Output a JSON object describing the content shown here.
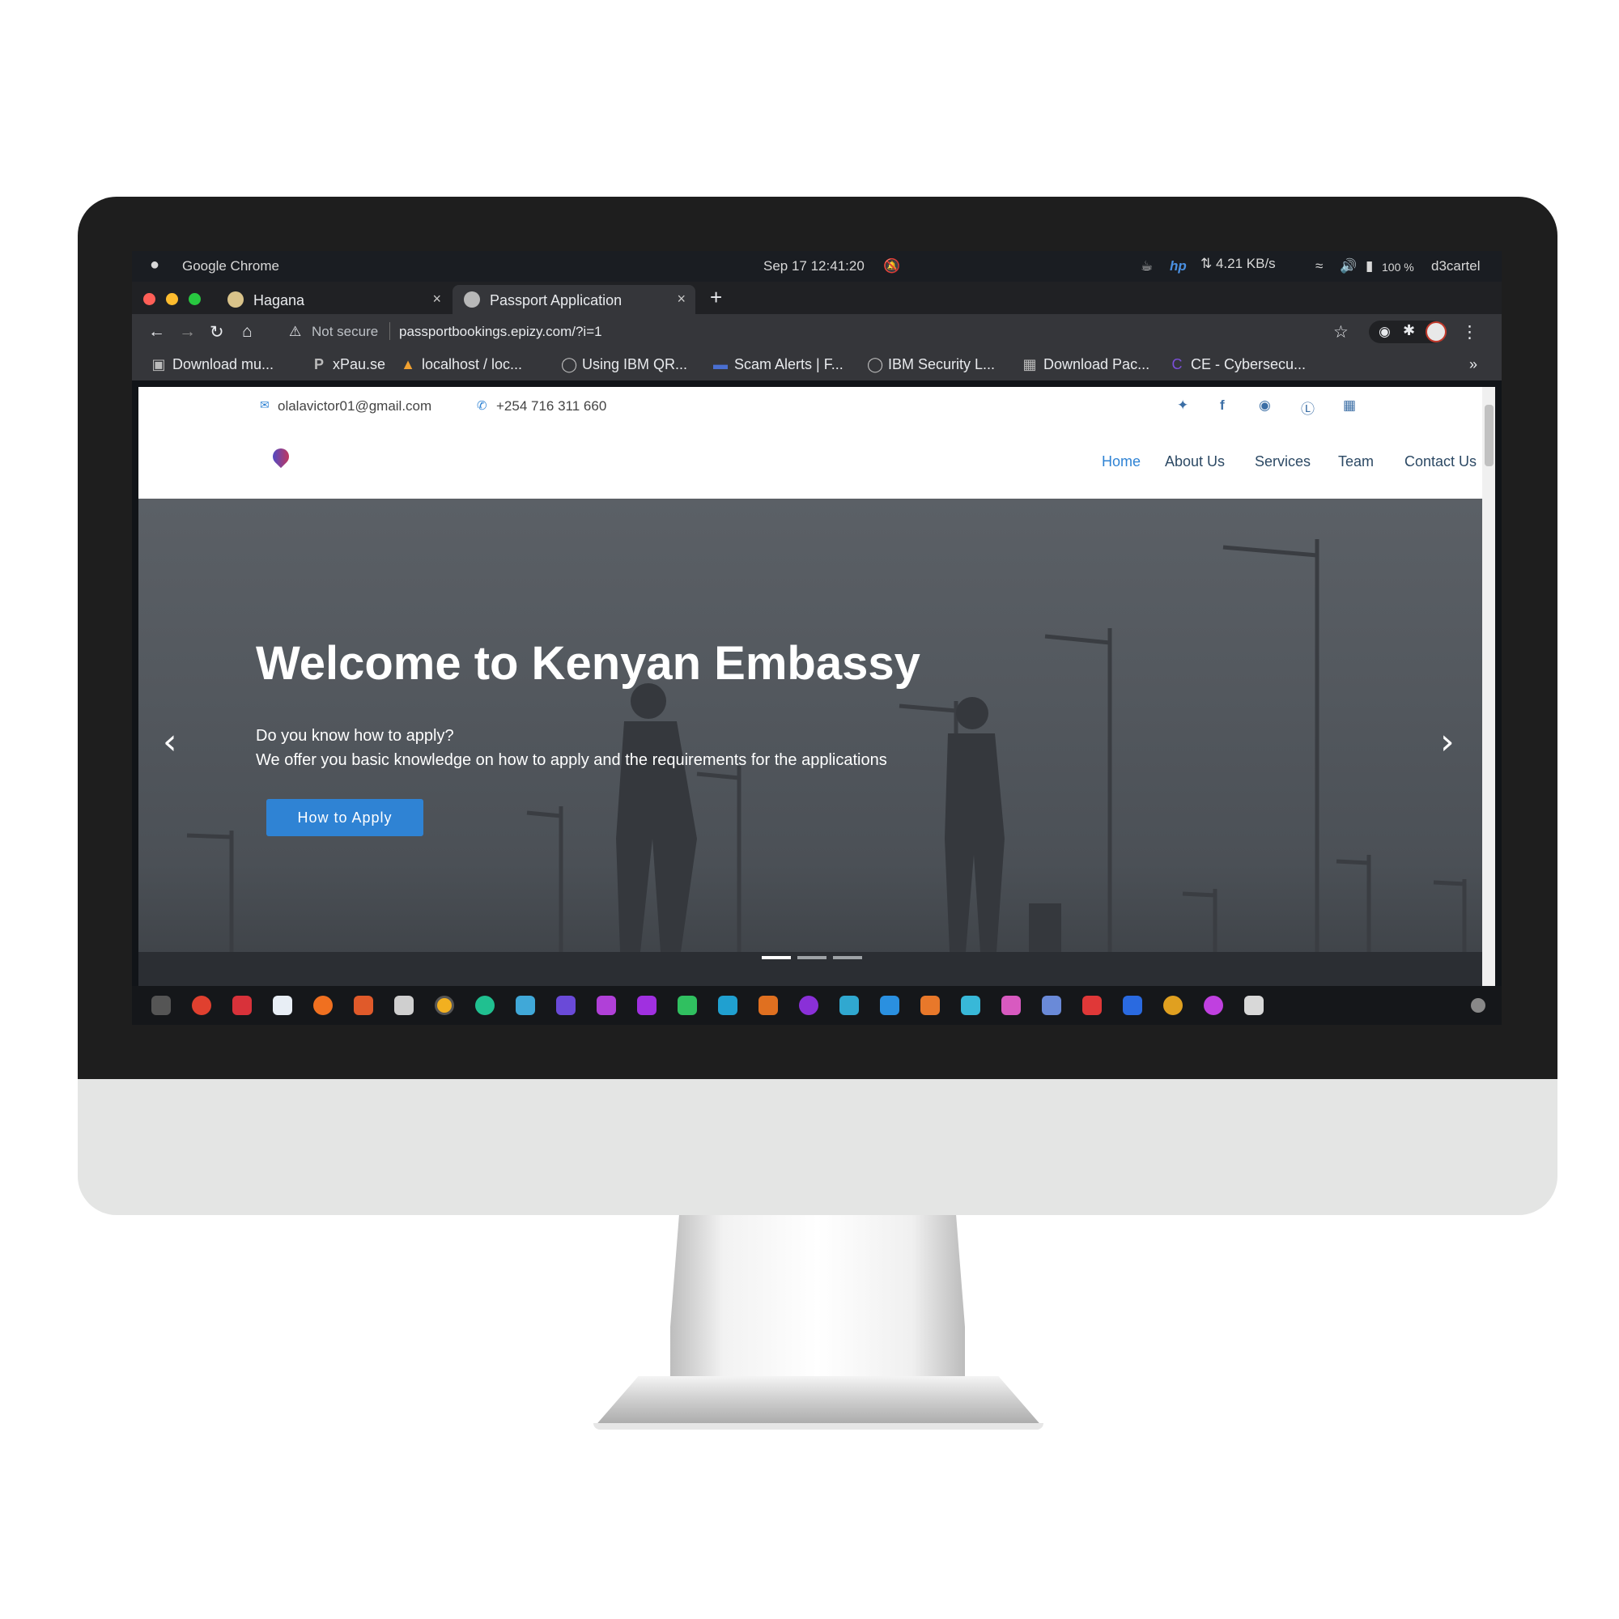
{
  "system_bar": {
    "app_name": "Google Chrome",
    "datetime": "Sep 17  12:41:20",
    "network_speed": "⇅ 4.21 KB/s",
    "battery": "100 %",
    "username": "d3cartel"
  },
  "tabs": [
    {
      "label": "Hagana",
      "close": "×"
    },
    {
      "label": "Passport Application",
      "close": "×"
    }
  ],
  "new_tab": "+",
  "address_bar": {
    "security": "Not secure",
    "url": "passportbookings.epizy.com/?i=1"
  },
  "bookmarks": [
    {
      "label": "Download mu...",
      "icon": "monitor-icon"
    },
    {
      "label": "xPau.se",
      "icon": "p-icon"
    },
    {
      "label": "localhost / loc...",
      "icon": "phpmyadmin-icon"
    },
    {
      "label": "Using IBM QR...",
      "icon": "shield-icon"
    },
    {
      "label": "Scam Alerts | F...",
      "icon": "flag-icon"
    },
    {
      "label": "IBM Security L...",
      "icon": "shield-icon"
    },
    {
      "label": "Download Pac...",
      "icon": "package-icon"
    },
    {
      "label": "CE - Cybersecu...",
      "icon": "ce-icon"
    }
  ],
  "bookmarks_overflow": "»",
  "site": {
    "email": "olalavictor01@gmail.com",
    "phone": "+254 716 311 660",
    "socials": [
      "twitter-icon",
      "facebook-icon",
      "instagram-icon",
      "skype-icon",
      "linkedin-icon"
    ],
    "nav": [
      "Home",
      "About Us",
      "Services",
      "Team",
      "Contact Us"
    ],
    "hero": {
      "title": "Welcome to Kenyan Embassy",
      "line1": "Do you know how to apply?",
      "line2": "We offer you basic knowledge on how to apply and the requirements for the applications",
      "button": "How to Apply",
      "prev": "‹",
      "next": "›"
    },
    "colors": {
      "nav_active": "#2f83d4",
      "nav": "#2c4964",
      "button": "#2f83d4"
    }
  },
  "dock_apps": [
    "terminal",
    "chart",
    "music",
    "photo",
    "browser",
    "office",
    "database",
    "chrome",
    "gitkraken",
    "box",
    "ide1",
    "ide2",
    "phpstorm",
    "pycharm",
    "webstorm",
    "sublime",
    "visual-studio",
    "terminal2",
    "vscode",
    "files",
    "sequel",
    "datagrip",
    "writer",
    "ansible",
    "vpn",
    "settings",
    "spotify",
    "drive"
  ]
}
